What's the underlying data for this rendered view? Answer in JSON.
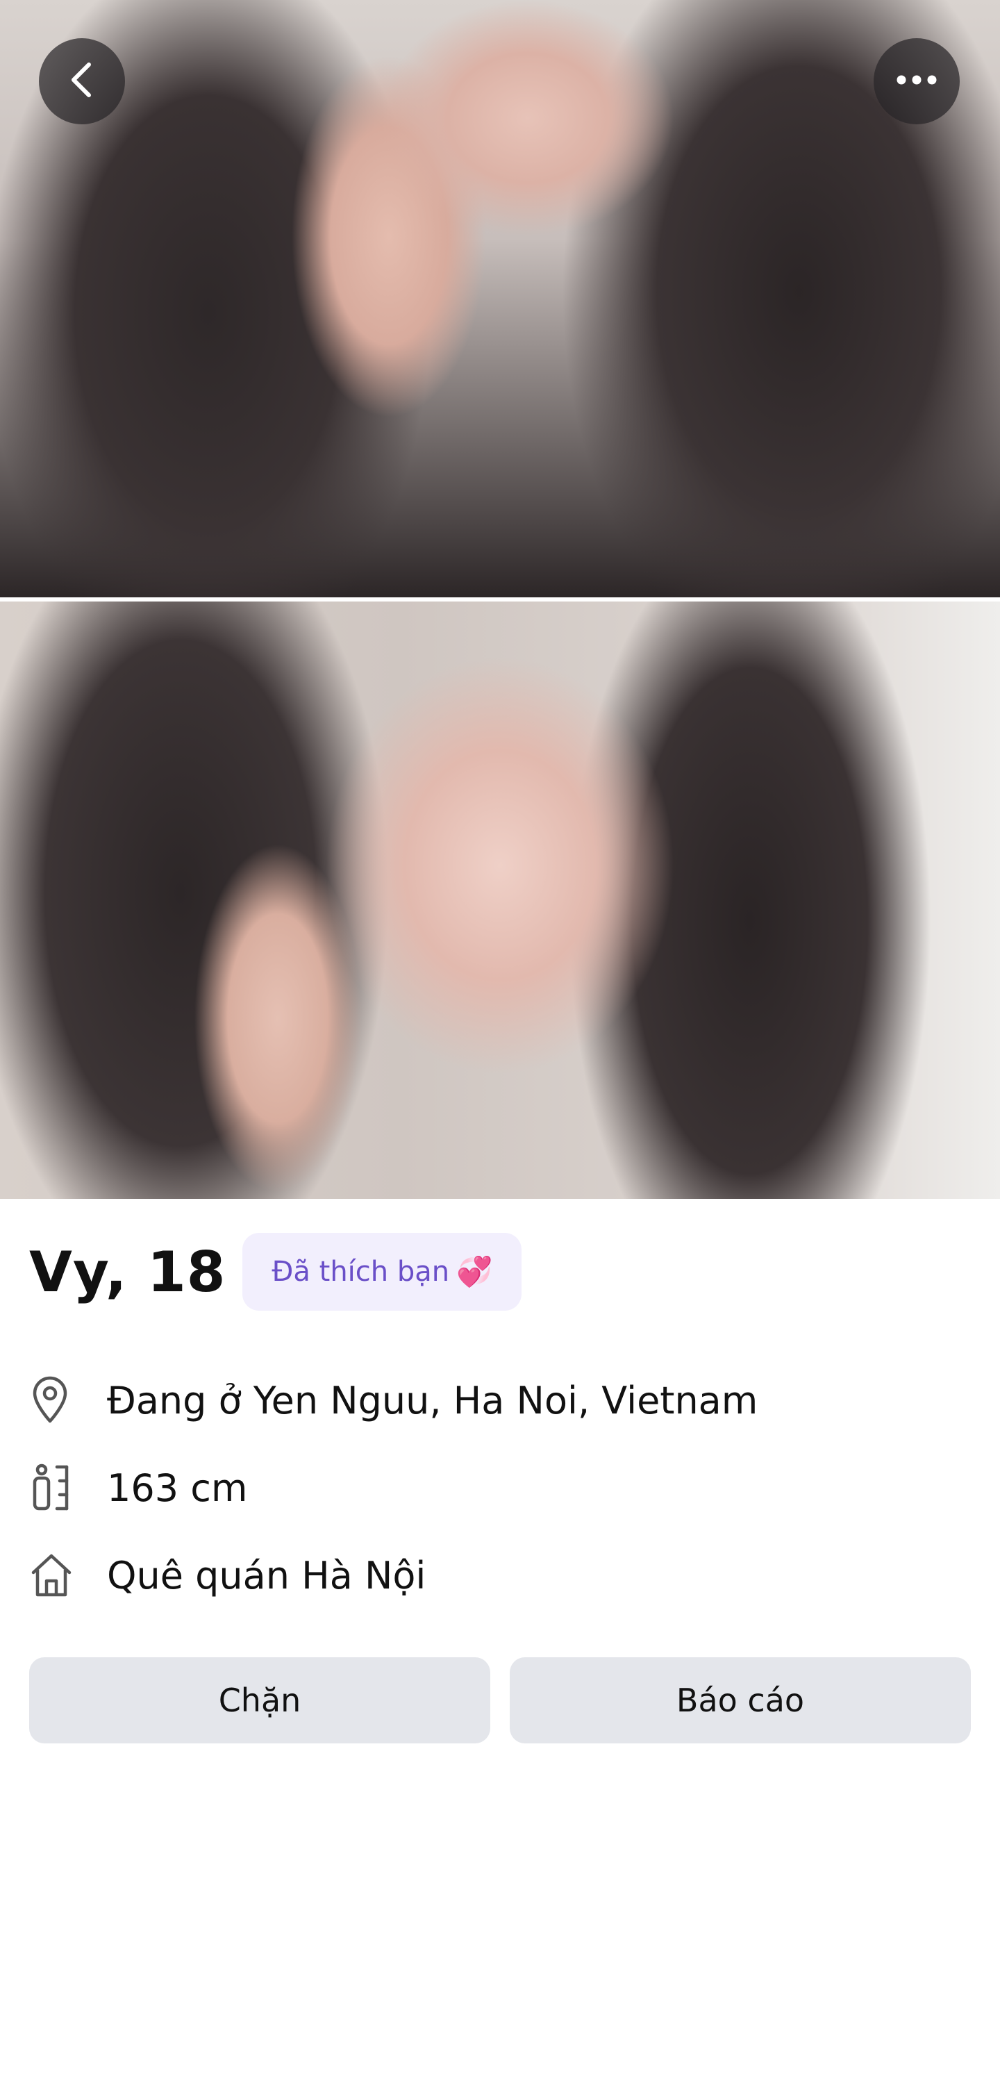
{
  "profile": {
    "name_age": "Vy, 18",
    "liked_badge": "Đã thích bạn",
    "liked_emoji": "💞"
  },
  "info": {
    "location": "Đang ở Yen Nguu, Ha Noi, Vietnam",
    "height": "163 cm",
    "hometown": "Quê quán Hà Nội"
  },
  "actions": {
    "block_label": "Chặn",
    "report_label": "Báo cáo"
  },
  "icons": {
    "back": "chevron-left-icon",
    "more": "more-horizontal-icon",
    "location": "map-pin-icon",
    "height": "height-ruler-icon",
    "home": "home-icon"
  },
  "colors": {
    "badge_bg": "#f2effd",
    "badge_text": "#6a4fc8",
    "button_bg": "#e4e6eb"
  }
}
